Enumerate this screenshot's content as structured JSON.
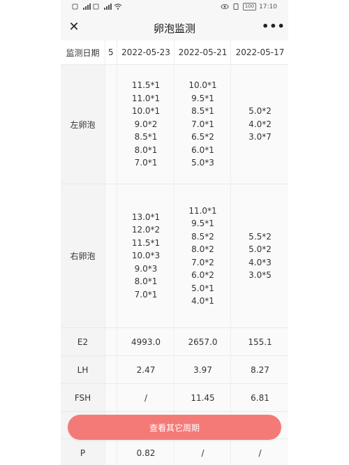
{
  "status": {
    "left_icons": [
      "sim-icon",
      "signal-icon",
      "sim-icon",
      "signal-icon",
      "wifi-icon"
    ],
    "right_icons": [
      "eye-icon",
      "vibrate-icon",
      "battery-icon"
    ],
    "battery": "100",
    "time": "17:10"
  },
  "nav": {
    "title": "卵泡监测",
    "close": "✕",
    "more": "•••"
  },
  "table": {
    "header": {
      "label": "监测日期",
      "cut": "5",
      "dates": [
        "2022-05-23",
        "2022-05-21",
        "2022-05-17"
      ]
    },
    "left": {
      "label": "左卵泡",
      "cols": [
        [
          "11.5*1",
          "11.0*1",
          "10.0*1",
          "9.0*2",
          "8.5*1",
          "8.0*1",
          "7.0*1"
        ],
        [
          "10.0*1",
          "9.5*1",
          "8.5*1",
          "7.0*1",
          "6.5*2",
          "6.0*1",
          "5.0*3"
        ],
        [
          "5.0*2",
          "4.0*2",
          "3.0*7"
        ]
      ]
    },
    "right": {
      "label": "右卵泡",
      "cols": [
        [
          "13.0*1",
          "12.0*2",
          "11.5*1",
          "10.0*3",
          "9.0*3",
          "8.0*1",
          "7.0*1"
        ],
        [
          "11.0*1",
          "9.5*1",
          "8.5*2",
          "8.0*2",
          "7.0*2",
          "6.0*2",
          "5.0*1",
          "4.0*1"
        ],
        [
          "5.5*2",
          "5.0*2",
          "4.0*3",
          "3.0*5"
        ]
      ]
    },
    "e2": {
      "label": "E2",
      "values": [
        "4993.0",
        "2657.0",
        "155.1"
      ]
    },
    "lh": {
      "label": "LH",
      "values": [
        "2.47",
        "3.97",
        "8.27"
      ]
    },
    "fsh": {
      "label": "FSH",
      "values": [
        "/",
        "11.45",
        "6.81"
      ]
    },
    "p": {
      "label": "P",
      "values": [
        "0.82",
        "/",
        "/"
      ]
    }
  },
  "cta": {
    "label": "查看其它周期"
  },
  "colors": {
    "cta_bg": "#f47a78",
    "page_bg": "#f7f7f7"
  }
}
